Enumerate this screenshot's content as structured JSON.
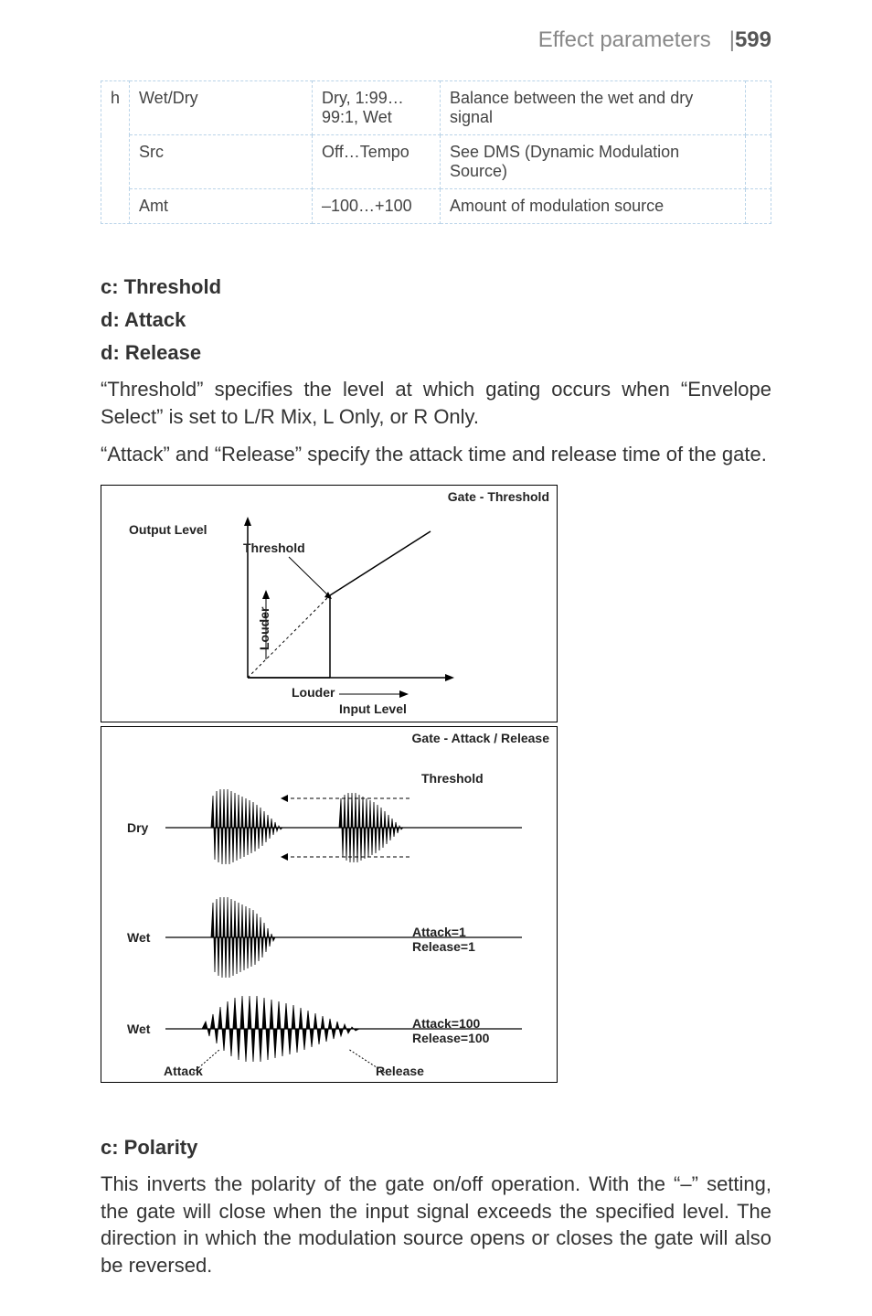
{
  "header": {
    "section_title": "Effect parameters",
    "divider": "|",
    "page_number": "599"
  },
  "table": {
    "rows": [
      {
        "a": "h",
        "b": "Wet/Dry",
        "c": "Dry, 1:99…99:1, Wet",
        "d": "Balance between the wet and dry signal",
        "e": ""
      },
      {
        "a": "",
        "b": "Src",
        "c": "Off…Tempo",
        "d": "See DMS (Dynamic Modulation Source)",
        "e": ""
      },
      {
        "a": "",
        "b": "Amt",
        "c": "–100…+100",
        "d": "Amount of modulation source",
        "e": ""
      }
    ]
  },
  "headings": {
    "threshold": "c: Threshold",
    "attack": "d: Attack",
    "release": "d: Release",
    "polarity": "c: Polarity"
  },
  "paragraphs": {
    "p1": "“Threshold” specifies the level at which gating occurs when “Envelope Select” is set to L/R Mix, L Only, or R Only.",
    "p2": "“Attack” and “Release” specify the attack time and release time of the gate.",
    "p3": "This inverts the polarity of the gate on/off operation. With the “–” setting, the gate will close when the input signal exceeds the specified level. The direction in which the modulation source opens or closes the gate will also be reversed."
  },
  "diagram1": {
    "title": "Gate - Threshold",
    "y_axis": "Output Level",
    "x_axis": "Input Level",
    "threshold_label": "Threshold",
    "louder_y": "Louder",
    "louder_x": "Louder"
  },
  "diagram2": {
    "title": "Gate - Attack / Release",
    "threshold_label": "Threshold",
    "row_dry": "Dry",
    "row_wet1": "Wet",
    "row_wet2": "Wet",
    "ar1_a": "Attack=1",
    "ar1_r": "Release=1",
    "ar2_a": "Attack=100",
    "ar2_r": "Release=100",
    "attack_label": "Attack",
    "release_label": "Release"
  }
}
